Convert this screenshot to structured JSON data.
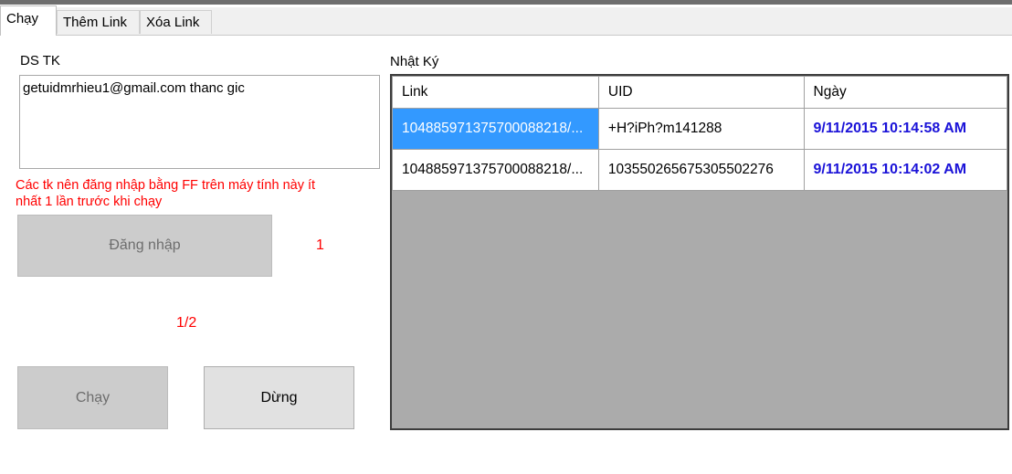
{
  "tabs": [
    {
      "label": "Chạy"
    },
    {
      "label": "Thêm Link"
    },
    {
      "label": "Xóa Link"
    }
  ],
  "accounts": {
    "label": "DS TK",
    "value": "getuidmrhieu1@gmail.com thanc    gic"
  },
  "note": "Các tk nên đăng nhập bằng FF trên máy tính này ít nhất 1 lần trước khi chạy",
  "login_button": "Đăng nhập",
  "login_count": "1",
  "progress": "1/2",
  "run_button": "Chạy",
  "stop_button": "Dừng",
  "log": {
    "label": "Nhật Ký",
    "columns": [
      "Link",
      "UID",
      "Ngày"
    ],
    "rows": [
      {
        "link": "1048859713757000882​18/...",
        "uid": "+H?iPh?m141288",
        "date": "9/11/2015 10:14:58 AM"
      },
      {
        "link": "1048859713757000882​18/...",
        "uid": "103550265675305502276",
        "date": "9/11/2015 10:14:02 AM"
      }
    ]
  },
  "colors": {
    "selection": "#3399ff",
    "date_text": "#1a12d8",
    "warning_text": "#ff0000",
    "grid_background": "#ababab"
  }
}
